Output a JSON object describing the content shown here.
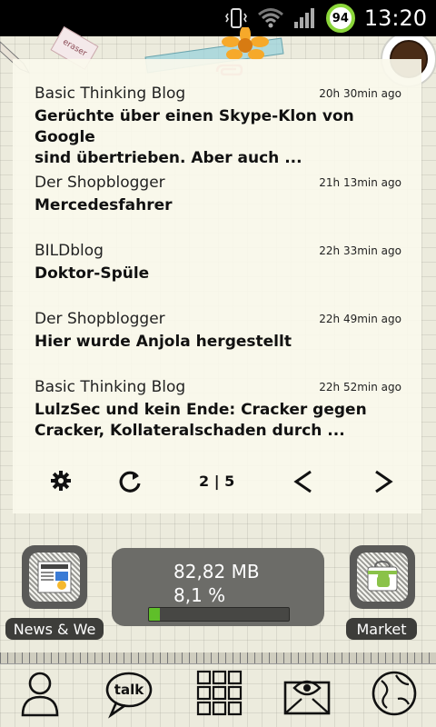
{
  "status_bar": {
    "icons": [
      "vibrate-icon",
      "wifi-icon",
      "signal-icon"
    ],
    "battery_level": "94",
    "time": "13:20"
  },
  "decorations": {
    "eraser_text": "eraser"
  },
  "feed": {
    "items": [
      {
        "source": "Basic Thinking Blog",
        "time": "20h 30min ago",
        "headline_line1": "Gerüchte über einen Skype-Klon von Google",
        "headline_line2": "sind übertrieben. Aber auch ..."
      },
      {
        "source": "Der Shopblogger",
        "time": "21h 13min ago",
        "headline_line1": "Mercedesfahrer",
        "headline_line2": ""
      },
      {
        "source": "BILDblog",
        "time": "22h 33min ago",
        "headline_line1": "Doktor-Spüle",
        "headline_line2": ""
      },
      {
        "source": "Der Shopblogger",
        "time": "22h 49min ago",
        "headline_line1": "Hier wurde Anjola hergestellt",
        "headline_line2": ""
      },
      {
        "source": "Basic Thinking Blog",
        "time": "22h 52min ago",
        "headline_line1": "LulzSec und kein Ende: Cracker gegen",
        "headline_line2": "Cracker, Kollateralschaden durch ..."
      }
    ],
    "toolbar": {
      "settings_icon": "gear-icon",
      "refresh_icon": "refresh-icon",
      "page_indicator": "2 | 5",
      "prev_icon": "chevron-left-icon",
      "next_icon": "chevron-right-icon"
    }
  },
  "apps": {
    "news": {
      "label": "News & We",
      "icon": "google-news-icon"
    },
    "market": {
      "label": "Market",
      "icon": "android-market-icon"
    }
  },
  "memory_widget": {
    "amount": "82,82 MB",
    "percent": "8,1 %",
    "fill_fraction": 0.081,
    "bar_color": "#5fbf29"
  },
  "dock": {
    "items": [
      {
        "name": "contacts",
        "icon": "person-icon"
      },
      {
        "name": "messaging",
        "icon": "talk-bubble-icon",
        "text": "talk"
      },
      {
        "name": "app-drawer",
        "icon": "grid-icon"
      },
      {
        "name": "email",
        "icon": "envelope-eye-icon"
      },
      {
        "name": "browser",
        "icon": "globe-icon"
      }
    ]
  }
}
